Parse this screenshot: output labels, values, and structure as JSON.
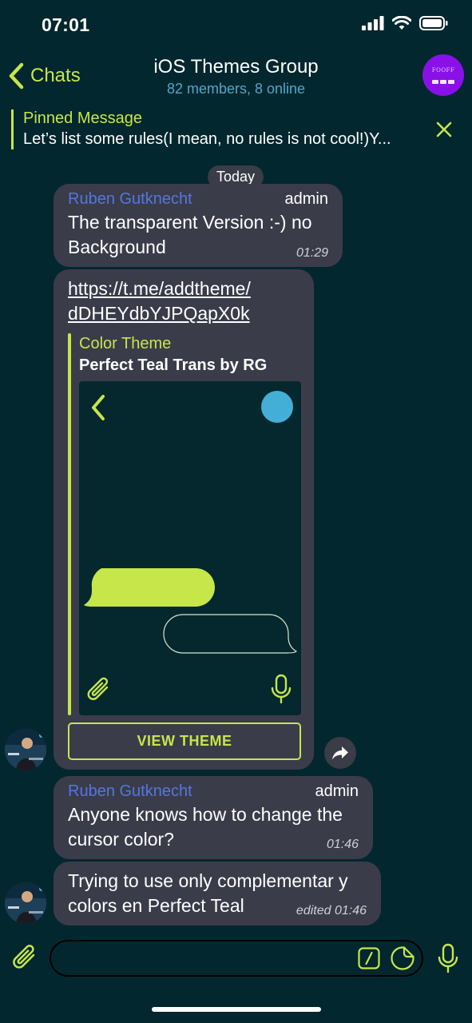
{
  "status_bar": {
    "time": "07:01",
    "icons": [
      "signal-icon",
      "wifi-icon",
      "battery-icon"
    ]
  },
  "nav": {
    "back_label": "Chats",
    "title": "iOS Themes Group",
    "subtitle": "82 members, 8 online",
    "avatar_text": "FOOFF"
  },
  "pinned": {
    "title": "Pinned Message",
    "text": "Let’s list some rules(I mean, no rules is not cool!)Y..."
  },
  "date_label": "Today",
  "messages": [
    {
      "sender": "Ruben Gutknecht",
      "role": "admin",
      "text_lines": [
        "The transparent Version :-) no",
        "Background"
      ],
      "time": "01:29"
    },
    {
      "link_lines": [
        "https://t.me/addtheme/",
        "dDHEYdbYJPQapX0k"
      ],
      "preview_kind": "Color Theme",
      "preview_name": "Perfect Teal Trans by RG",
      "button_label": "VIEW THEME"
    },
    {
      "sender": "Ruben Gutknecht",
      "role": "admin",
      "text_lines": [
        "Anyone knows how to change the",
        "cursor color?"
      ],
      "time": "01:46"
    },
    {
      "text_lines": [
        "Trying to use only complementar y",
        "colors en Perfect Teal"
      ],
      "time": "edited 01:46"
    }
  ],
  "input": {
    "placeholder": ""
  },
  "colors": {
    "background": "#03272e",
    "accent": "#c6e64a",
    "bubble": "#3b3c4a",
    "sender": "#5277e0",
    "subtitle": "#55a3c9",
    "avatar_bg": "#8a10e8"
  }
}
